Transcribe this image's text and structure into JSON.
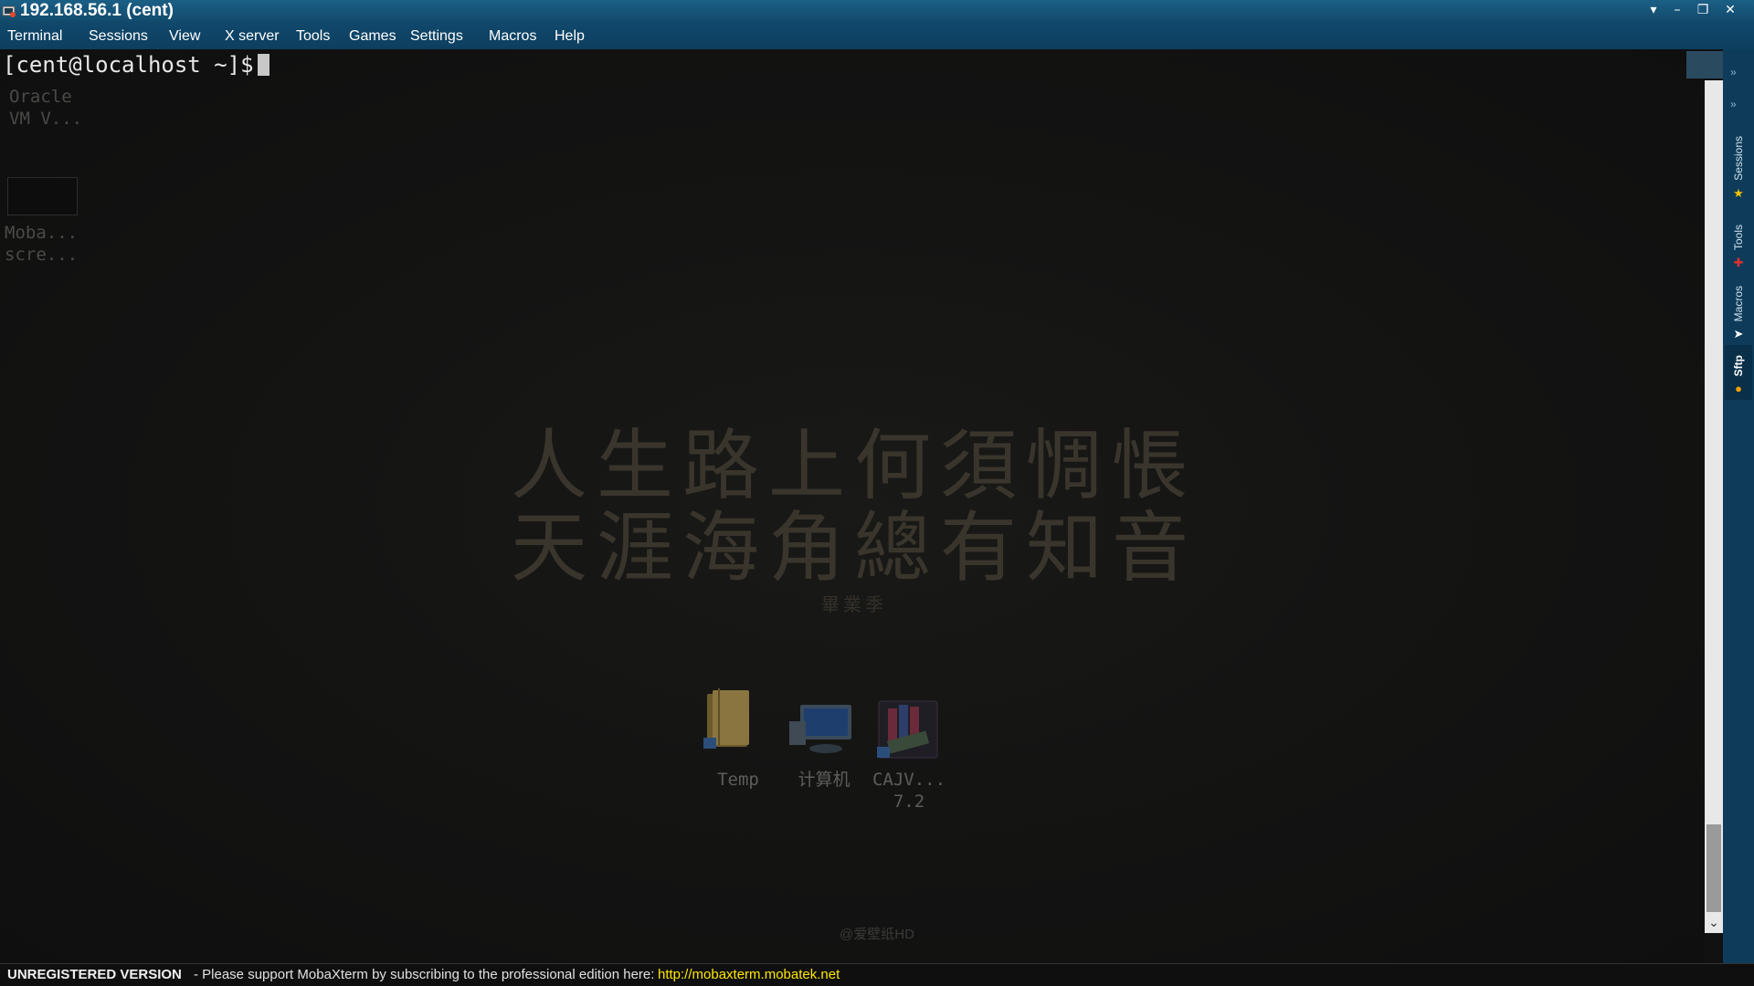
{
  "window": {
    "title": "192.168.56.1 (cent)",
    "controls": [
      "chevron-down-icon",
      "minimize-icon",
      "restore-icon",
      "close-icon"
    ]
  },
  "menu": {
    "items": [
      "Terminal",
      "Sessions",
      "View",
      "X server",
      "Tools",
      "Games",
      "Settings",
      "Macros",
      "Help"
    ]
  },
  "terminal": {
    "prompt": "[cent@localhost ~]$"
  },
  "desktop": {
    "shortcuts_left": [
      {
        "label_line1": "Oracle",
        "label_line2": "VM V..."
      },
      {
        "label_line1": "Moba...",
        "label_line2": "scre..."
      }
    ],
    "wallpaper": {
      "line1": "人生路上何須惆悵",
      "line2": "天涯海角總有知音",
      "signature": "畢業季",
      "watermark": "@爱壁纸HD"
    },
    "icons": [
      {
        "label": "Temp",
        "icon": "folder-icon"
      },
      {
        "label": "计算机",
        "icon": "computer-icon"
      },
      {
        "label_line1": "CAJV...",
        "label_line2": "7.2",
        "icon": "books-icon"
      }
    ]
  },
  "sidebar": {
    "tabs": [
      {
        "label": "Sessions",
        "icon": "star-icon",
        "icon_color": "#f5c400"
      },
      {
        "label": "Tools",
        "icon": "tools-icon",
        "icon_color": "#e03030"
      },
      {
        "label": "Macros",
        "icon": "paper-plane-icon",
        "icon_color": "#ffffff"
      },
      {
        "label": "Sftp",
        "icon": "globe-icon",
        "icon_color": "#f5a000"
      }
    ]
  },
  "statusbar": {
    "bold": "UNREGISTERED VERSION",
    "message": "-   Please support MobaXterm by subscribing to the professional edition here:",
    "link": "http://mobaxterm.mobatek.net"
  },
  "colors": {
    "titlebar": "#1b5f86",
    "menubar": "#0d3f60",
    "link": "#ffe600"
  }
}
